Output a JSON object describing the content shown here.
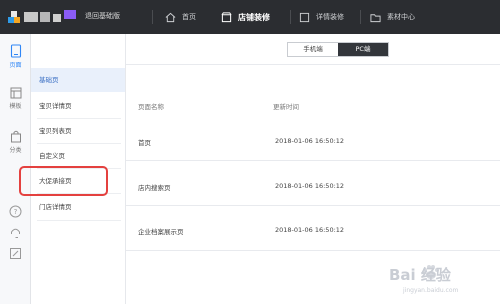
{
  "header": {
    "back_label": "退回基础版",
    "nav": [
      {
        "label": "首页",
        "icon": "home-icon"
      },
      {
        "label": "店铺装修",
        "icon": "store-icon"
      },
      {
        "label": "详情装修",
        "icon": "detail-icon"
      },
      {
        "label": "素材中心",
        "icon": "folder-icon"
      }
    ],
    "active_nav": "店铺装修"
  },
  "rail": {
    "items": [
      {
        "label": "页面",
        "icon": "page-icon",
        "active": true
      },
      {
        "label": "模板",
        "icon": "template-icon",
        "active": false
      },
      {
        "label": "分类",
        "icon": "bag-icon",
        "active": false
      }
    ],
    "tools": [
      "help-icon",
      "headset-icon",
      "edit-icon"
    ]
  },
  "menu": {
    "items": [
      "基础页",
      "宝贝详情页",
      "宝贝列表页",
      "自定义页",
      "大促承接页",
      "门店详情页"
    ],
    "active": "基础页",
    "highlighted": "大促承接页"
  },
  "device_switch": {
    "options": [
      "手机端",
      "PC端"
    ],
    "selected": "PC端"
  },
  "table": {
    "headers": [
      "页面名称",
      "更新时间"
    ],
    "rows": [
      {
        "name": "首页",
        "time": "2018-01-06 16:50:12"
      },
      {
        "name": "店内搜索页",
        "time": "2018-01-06 16:50:12"
      },
      {
        "name": "企业档案展示页",
        "time": "2018-01-06 16:50:12"
      }
    ]
  },
  "watermark": {
    "text": "Bai 经验",
    "sub": "jingyan.baidu.com"
  },
  "colors": {
    "topbar": "#2b2d31",
    "accent": "#2f86f6",
    "highlight": "#e4413f",
    "switch_selected": "#33363b"
  }
}
